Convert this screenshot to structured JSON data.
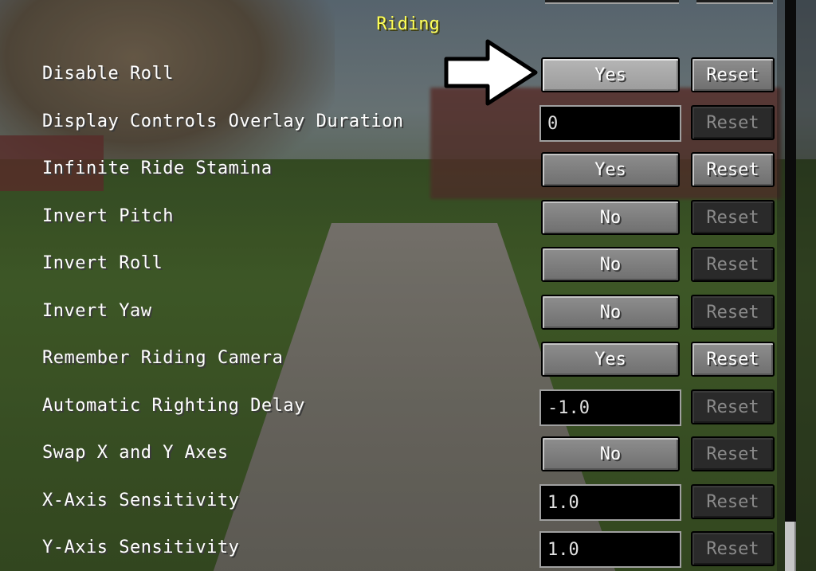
{
  "section": {
    "title": "Riding"
  },
  "options": [
    {
      "label": "Disable Roll",
      "control": "button",
      "value": "Yes",
      "reset": "Reset",
      "reset_enabled": true,
      "highlighted": true
    },
    {
      "label": "Display Controls Overlay Duration",
      "control": "field",
      "value": "0",
      "reset": "Reset",
      "reset_enabled": false
    },
    {
      "label": "Infinite Ride Stamina",
      "control": "button",
      "value": "Yes",
      "reset": "Reset",
      "reset_enabled": true
    },
    {
      "label": "Invert Pitch",
      "control": "button",
      "value": "No",
      "reset": "Reset",
      "reset_enabled": false
    },
    {
      "label": "Invert Roll",
      "control": "button",
      "value": "No",
      "reset": "Reset",
      "reset_enabled": false
    },
    {
      "label": "Invert Yaw",
      "control": "button",
      "value": "No",
      "reset": "Reset",
      "reset_enabled": false
    },
    {
      "label": "Remember Riding Camera",
      "control": "button",
      "value": "Yes",
      "reset": "Reset",
      "reset_enabled": true
    },
    {
      "label": "Automatic Righting Delay",
      "control": "field",
      "value": "-1.0",
      "reset": "Reset",
      "reset_enabled": false
    },
    {
      "label": "Swap X and Y Axes",
      "control": "button",
      "value": "No",
      "reset": "Reset",
      "reset_enabled": false
    },
    {
      "label": "X-Axis Sensitivity",
      "control": "field",
      "value": "1.0",
      "reset": "Reset",
      "reset_enabled": false
    },
    {
      "label": "Y-Axis Sensitivity",
      "control": "field",
      "value": "1.0",
      "reset": "Reset",
      "reset_enabled": false
    }
  ],
  "colors": {
    "title": "#ffff55",
    "label": "#ffffff",
    "disabled_text": "#8a8a8a"
  },
  "annotation": {
    "icon": "white-arrow-icon"
  }
}
